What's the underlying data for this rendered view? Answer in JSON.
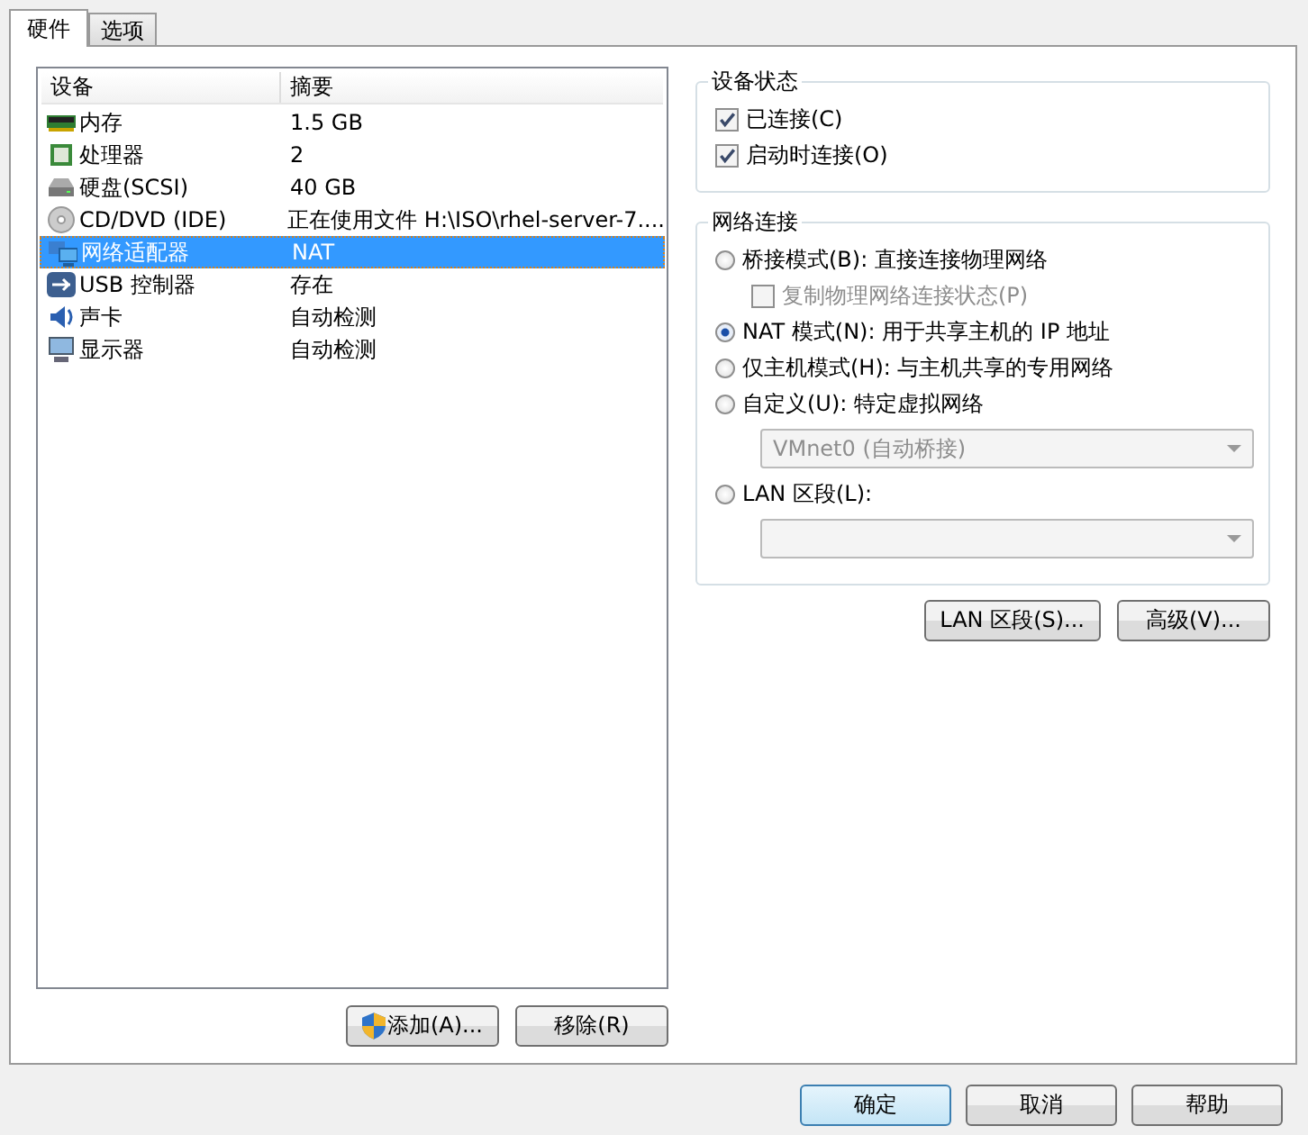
{
  "tabs": [
    {
      "label": "硬件",
      "selected": true
    },
    {
      "label": "选项",
      "selected": false
    }
  ],
  "device_list": {
    "columns": [
      "设备",
      "摘要"
    ],
    "rows": [
      {
        "kind": "memory",
        "device": "内存",
        "summary": "1.5 GB",
        "selected": false
      },
      {
        "kind": "cpu",
        "device": "处理器",
        "summary": "2",
        "selected": false
      },
      {
        "kind": "disk",
        "device": "硬盘(SCSI)",
        "summary": "40 GB",
        "selected": false
      },
      {
        "kind": "cd",
        "device": "CD/DVD (IDE)",
        "summary": "正在使用文件 H:\\ISO\\rhel-server-7....",
        "selected": false
      },
      {
        "kind": "network",
        "device": "网络适配器",
        "summary": "NAT",
        "selected": true
      },
      {
        "kind": "usb",
        "device": "USB 控制器",
        "summary": "存在",
        "selected": false
      },
      {
        "kind": "sound",
        "device": "声卡",
        "summary": "自动检测",
        "selected": false
      },
      {
        "kind": "display",
        "device": "显示器",
        "summary": "自动检测",
        "selected": false
      }
    ],
    "buttons": [
      {
        "label": "添加(A)...",
        "shield": true
      },
      {
        "label": "移除(R)",
        "shield": false
      }
    ]
  },
  "device_status": {
    "title": "设备状态",
    "options": [
      {
        "label": "已连接(C)",
        "checked": true
      },
      {
        "label": "启动时连接(O)",
        "checked": true
      }
    ]
  },
  "network_connection": {
    "title": "网络连接",
    "options": [
      {
        "label": "桥接模式(B): 直接连接物理网络",
        "selected": false,
        "checkbox": {
          "label": "复制物理网络连接状态(P)",
          "checked": false,
          "disabled": true
        }
      },
      {
        "label": "NAT 模式(N): 用于共享主机的 IP 地址",
        "selected": true
      },
      {
        "label": "仅主机模式(H): 与主机共享的专用网络",
        "selected": false
      },
      {
        "label": "自定义(U): 特定虚拟网络",
        "selected": false,
        "dropdown": {
          "value": "VMnet0 (自动桥接)",
          "disabled": true
        }
      },
      {
        "label": "LAN 区段(L):",
        "selected": false,
        "dropdown": {
          "disabled": true
        }
      }
    ]
  },
  "network_buttons": [
    "LAN 区段(S)...",
    "高级(V)..."
  ],
  "dialog_buttons": [
    {
      "label": "确定",
      "default": true
    },
    {
      "label": "取消",
      "default": false
    },
    {
      "label": "帮助",
      "default": false
    }
  ]
}
